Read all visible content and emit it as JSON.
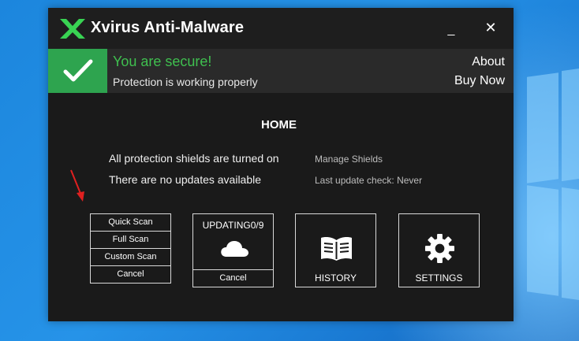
{
  "app": {
    "title": "Xvirus Anti-Malware",
    "minimize_glyph": "_",
    "close_glyph": "✕"
  },
  "status": {
    "title": "You are secure!",
    "subtitle": "Protection is working properly",
    "about": "About",
    "buy_now": "Buy Now"
  },
  "main": {
    "heading": "HOME",
    "shields_text": "All protection shields are turned on",
    "manage_shields": "Manage Shields",
    "updates_text": "There are no updates available",
    "last_update": "Last update check: Never"
  },
  "scan": {
    "quick": "Quick Scan",
    "full": "Full Scan",
    "custom": "Custom Scan",
    "cancel": "Cancel"
  },
  "update_tile": {
    "label": "UPDATING0/9",
    "cancel": "Cancel"
  },
  "history_tile": {
    "label": "HISTORY"
  },
  "settings_tile": {
    "label": "SETTINGS"
  },
  "colors": {
    "accent_green": "#2ea44f",
    "status_text_green": "#3fbf4f",
    "logo_green": "#39d353",
    "arrow_red": "#e02020"
  },
  "icons": [
    "x-logo-icon",
    "checkmark-icon",
    "cloud-icon",
    "book-icon",
    "gear-icon",
    "arrow-annotation-icon"
  ]
}
